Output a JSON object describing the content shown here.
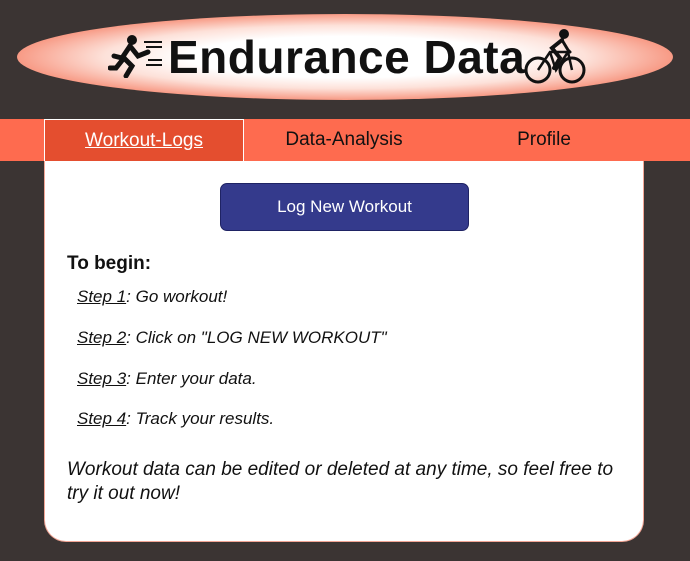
{
  "header": {
    "title": "Endurance Data",
    "left_icon": "runner-icon",
    "right_icon": "cyclist-icon"
  },
  "tabs": [
    {
      "label": "Workout-Logs",
      "active": true
    },
    {
      "label": "Data-Analysis",
      "active": false
    },
    {
      "label": "Profile",
      "active": false
    }
  ],
  "main": {
    "button_label": "Log New Workout",
    "heading": "To begin:",
    "steps": [
      {
        "link": "Step 1",
        "text": ": Go workout!"
      },
      {
        "link": "Step 2",
        "text": ": Click on \"LOG NEW WORKOUT\""
      },
      {
        "link": "Step 3",
        "text": ": Enter your data."
      },
      {
        "link": "Step 4",
        "text": ": Track your results."
      }
    ],
    "note": "Workout data can be edited or deleted at any time, so feel free to try it out now!"
  },
  "colors": {
    "background": "#3b3433",
    "tab_bar": "#fe6b4f",
    "active_tab": "#e44e2f",
    "button": "#343a8c"
  }
}
